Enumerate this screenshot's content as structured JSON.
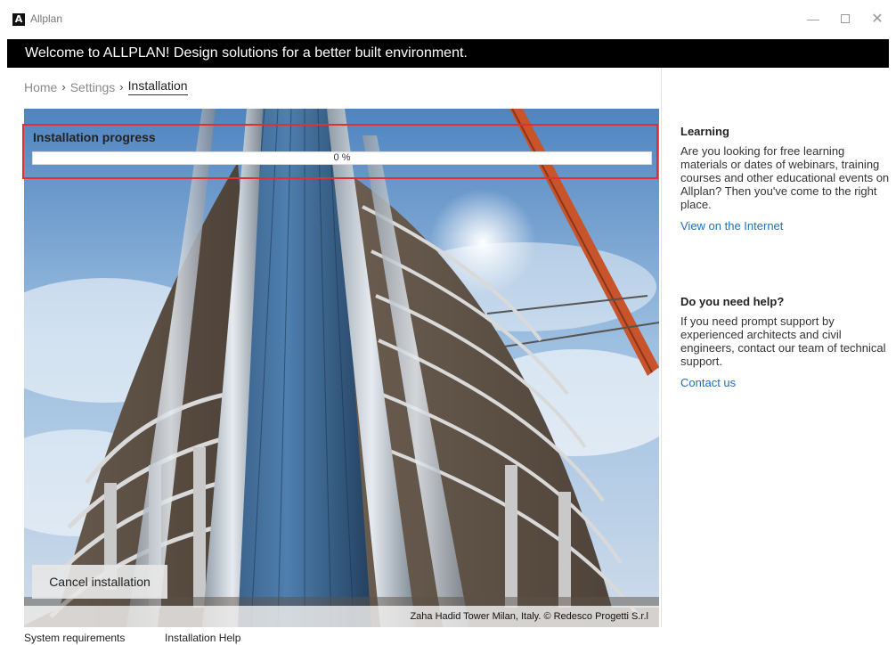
{
  "window": {
    "app_title": "Allplan",
    "logo_glyph": "A",
    "minimize_glyph": "—",
    "close_glyph": "✕",
    "icons": [
      "allplan-logo-icon",
      "minimize-icon",
      "maximize-icon",
      "close-icon"
    ]
  },
  "banner": {
    "text": "Welcome to ALLPLAN! Design solutions for a better built environment."
  },
  "breadcrumb": {
    "items": [
      "Home",
      "Settings",
      "Installation"
    ],
    "separator": "›"
  },
  "progress": {
    "title": "Installation progress",
    "percent": 0,
    "label": "0 %"
  },
  "photo": {
    "caption": "Zaha Hadid Tower Milan, Italy. © Redesco Progetti S.r.l"
  },
  "actions": {
    "cancel_label": "Cancel installation"
  },
  "side": {
    "learning": {
      "heading": "Learning",
      "text": "Are you looking for free learning materials or dates of webinars, training courses and other educational events on Allplan? Then you've come to the right place.",
      "link": "View on the Internet"
    },
    "help": {
      "heading": "Do you need help?",
      "text": "If you need prompt support by experienced architects and civil engineers, contact our team of technical support.",
      "link": "Contact us"
    }
  },
  "footer": {
    "system_requirements": "System requirements",
    "installation_help": "Installation Help"
  },
  "colors": {
    "banner_bg": "#000000",
    "link": "#1f6fc7",
    "highlight_border": "#e03030",
    "progress_fill": "#3b7ddd"
  }
}
